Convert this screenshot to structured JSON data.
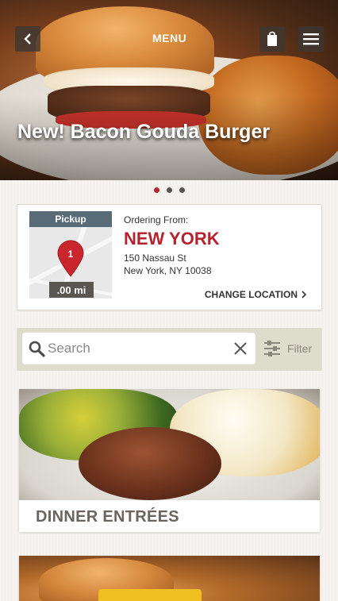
{
  "hero": {
    "menu_label": "MENU",
    "title": "New! Bacon Gouda Burger",
    "slides_total": 3,
    "active_slide": 1
  },
  "location": {
    "pickup_label": "Pickup",
    "pin_number": "1",
    "distance": ".00 mi",
    "ordering_from_label": "Ordering From:",
    "city": "NEW YORK",
    "address_line1": "150 Nassau St",
    "address_line2": "New York, NY 10038",
    "change_location_label": "CHANGE LOCATION"
  },
  "search": {
    "placeholder": "Search",
    "filter_label": "Filter"
  },
  "categories": [
    {
      "label": "DINNER ENTRÉES"
    },
    {
      "label": ""
    }
  ],
  "colors": {
    "accent": "#b5232f",
    "button_bg": "#3c3732",
    "search_bar_bg": "#dedccd",
    "page_bg": "#f4f1ec"
  },
  "icons": {
    "back": "chevron-left-icon",
    "cart": "shopping-bag-icon",
    "menu": "hamburger-icon",
    "pin": "map-pin-icon",
    "search": "magnifier-icon",
    "clear": "close-icon",
    "filter": "sliders-icon",
    "chevron": "chevron-right-icon"
  }
}
